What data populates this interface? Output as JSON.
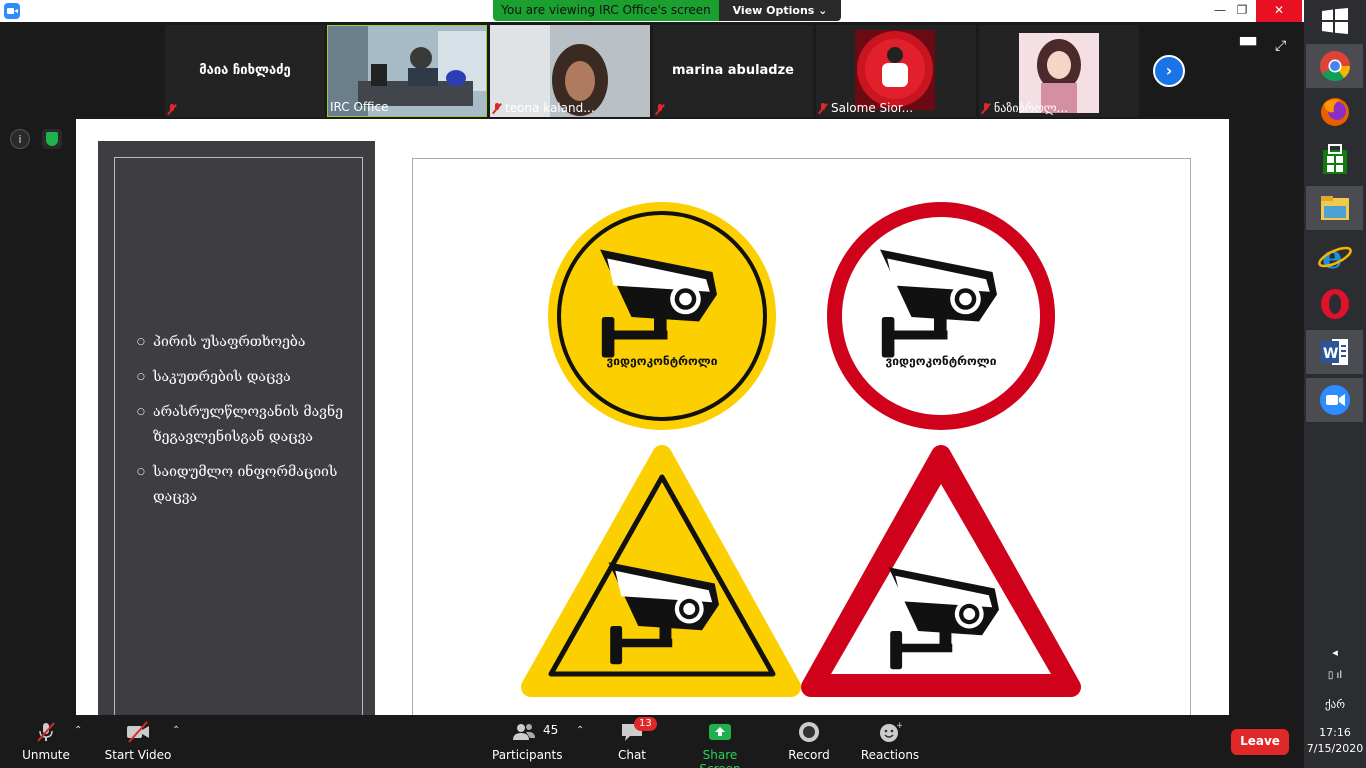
{
  "window": {
    "share_banner": "You are viewing IRC Office's screen",
    "view_options": "View Options ⌄",
    "minimize": "—",
    "restore": "❐",
    "close": "✕"
  },
  "participants_strip": [
    {
      "name": "მაია ჩიხლაძე",
      "label": ""
    },
    {
      "name": "",
      "label": "IRC Office"
    },
    {
      "name": "",
      "label": "teona kaland..."
    },
    {
      "name": "marina abuladze",
      "label": ""
    },
    {
      "name": "",
      "label": "Salome Sior..."
    },
    {
      "name": "",
      "label": "ნაზიბროლ..."
    }
  ],
  "slide": {
    "bullets": [
      "პირის უსაფრთხოება",
      "საკუთრების დაცვა",
      "არასრულწლოვანის მავნე ზეგავლენისგან დაცვა",
      "საიდუმლო ინფორმაციის დაცვა"
    ],
    "sign_text": "ვიდეოკონტროლი"
  },
  "toolbar": {
    "unmute": "Unmute",
    "start_video": "Start Video",
    "participants": "Participants",
    "participants_count": "45",
    "chat": "Chat",
    "chat_badge": "13",
    "share_screen": "Share Screen",
    "record": "Record",
    "reactions": "Reactions",
    "leave": "Leave"
  },
  "taskbar": {
    "language": "ქარ",
    "time": "17:16",
    "date": "7/15/2020",
    "apps": [
      "chrome-icon",
      "firefox-icon",
      "store-icon",
      "file-explorer-icon",
      "internet-explorer-icon",
      "opera-icon",
      "word-icon",
      "zoom-icon"
    ]
  },
  "colors": {
    "share_green": "#19a02f",
    "leave_red": "#e02828",
    "sign_yellow": "#fcd000",
    "sign_red": "#d0021b",
    "slide_panel": "#3e3d42"
  }
}
